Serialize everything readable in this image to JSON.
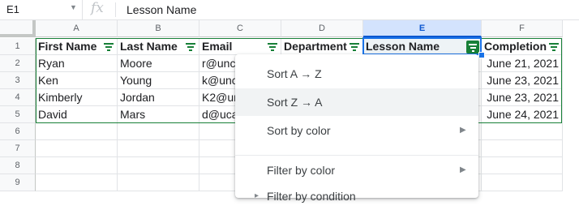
{
  "formula_bar": {
    "cell_ref": "E1",
    "fx_label": "fx",
    "value": "Lesson Name"
  },
  "columns": [
    "A",
    "B",
    "C",
    "D",
    "E",
    "F"
  ],
  "rows": [
    "1",
    "2",
    "3",
    "4",
    "5",
    "6",
    "7",
    "8",
    "9"
  ],
  "headers": {
    "first_name": "First Name",
    "last_name": "Last Name",
    "email": "Email",
    "department": "Department",
    "lesson_name": "Lesson Name",
    "completion": "Completion"
  },
  "data_rows": [
    {
      "first": "Ryan",
      "last": "Moore",
      "email": "r@unca",
      "completion": "June 21, 2021"
    },
    {
      "first": "Ken",
      "last": "Young",
      "email": "k@unc",
      "completion": "June 23, 2021"
    },
    {
      "first": "Kimberly",
      "last": "Jordan",
      "email": "K2@ur",
      "completion": "June 23, 2021"
    },
    {
      "first": "David",
      "last": "Mars",
      "email": "d@uca",
      "completion": "June 24, 2021"
    }
  ],
  "menu": {
    "sort_az": "Sort A → Z",
    "sort_za": "Sort Z → A",
    "sort_by_color": "Sort by color",
    "filter_by_color": "Filter by color",
    "filter_by_condition": "Filter by condition"
  },
  "colors": {
    "filter_green": "#188038",
    "selection_blue": "#1a73e8"
  }
}
